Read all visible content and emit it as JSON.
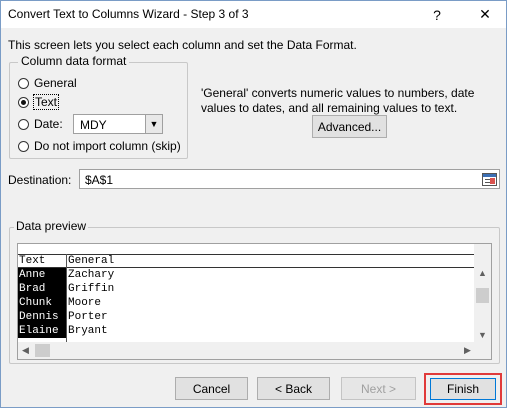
{
  "window": {
    "title": "Convert Text to Columns Wizard - Step 3 of 3",
    "help_label": "?",
    "close_label": "✕"
  },
  "intro_text": "This screen lets you select each column and set the Data Format.",
  "column_format": {
    "group_title": "Column data format",
    "options": [
      {
        "label": "General",
        "checked": false
      },
      {
        "label": "Text",
        "checked": true
      },
      {
        "label": "Date:",
        "checked": false
      },
      {
        "label": "Do not import column (skip)",
        "checked": false
      }
    ],
    "date_format": "MDY"
  },
  "description": "'General' converts numeric values to numbers, date values to dates, and all remaining values to text.",
  "advanced_label": "Advanced...",
  "destination": {
    "label": "Destination:",
    "value": "$A$1"
  },
  "preview": {
    "title": "Data preview",
    "headers": [
      "Text",
      "General"
    ],
    "rows": [
      [
        "Anne",
        "Zachary"
      ],
      [
        "Brad",
        "Griffin"
      ],
      [
        "Chunk",
        "Moore"
      ],
      [
        "Dennis",
        "Porter"
      ],
      [
        "Elaine",
        "Bryant"
      ]
    ]
  },
  "buttons": {
    "cancel": "Cancel",
    "back": "< Back",
    "next": "Next >",
    "finish": "Finish"
  },
  "colors": {
    "highlight": "#e03a3a",
    "selected_column": "#000000",
    "title_bar": "#ffffff"
  }
}
